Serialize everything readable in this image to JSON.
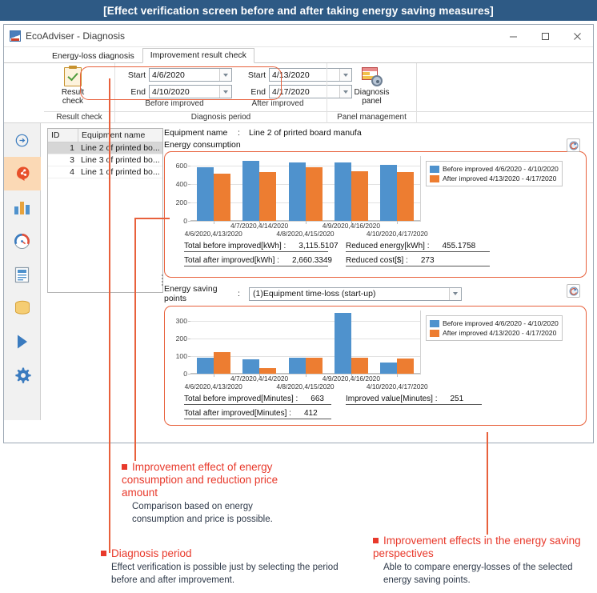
{
  "banner": {
    "text": "[Effect verification screen before and after taking energy saving measures]"
  },
  "window": {
    "title": "EcoAdviser - Diagnosis",
    "minimize": "–",
    "maximize": "□",
    "close": "✕"
  },
  "tabs": [
    {
      "label": "Energy-loss diagnosis",
      "active": false
    },
    {
      "label": "Improvement result check",
      "active": true
    }
  ],
  "ribbon": {
    "result_check": {
      "button_label_line1": "Result",
      "button_label_line2": "check",
      "group_title": "Result check"
    },
    "period": {
      "group_title": "Diagnosis period",
      "before": {
        "start_label": "Start",
        "start_value": "4/6/2020",
        "end_label": "End",
        "end_value": "4/10/2020",
        "caption": "Before improved"
      },
      "after": {
        "start_label": "Start",
        "start_value": "4/13/2020",
        "end_label": "End",
        "end_value": "4/17/2020",
        "caption": "After improved"
      }
    },
    "panel": {
      "button_label_line1": "Diagnosis",
      "button_label_line2": "panel",
      "group_title": "Panel management"
    }
  },
  "sidebar": {
    "items": [
      {
        "name": "expand-icon",
        "selected": false
      },
      {
        "name": "diagnosis-head-icon",
        "selected": true
      },
      {
        "name": "bar-chart-icon",
        "selected": false
      },
      {
        "name": "gauge-icon",
        "selected": false
      },
      {
        "name": "report-icon",
        "selected": false
      },
      {
        "name": "database-icon",
        "selected": false
      },
      {
        "name": "play-icon",
        "selected": false
      },
      {
        "name": "settings-gear-icon",
        "selected": false
      }
    ]
  },
  "equipment_list": {
    "headers": [
      "ID",
      "Equipment name"
    ],
    "rows": [
      {
        "id": "1",
        "name": "Line 2 of printed bo...",
        "selected": true
      },
      {
        "id": "3",
        "name": "Line 3 of printed bo...",
        "selected": false
      },
      {
        "id": "4",
        "name": "Line 1 of printed bo...",
        "selected": false
      }
    ]
  },
  "details": {
    "equipment_name_label": "Equipment name",
    "colon": ":",
    "equipment_name_value": "Line 2 of prirted board manufa",
    "energy_consumption_label": "Energy consumption",
    "energy_saving_points_label": "Energy saving points",
    "energy_saving_points_value": "(1)Equipment time-loss (start-up)",
    "refresh_icon": "refresh-icon"
  },
  "energy_totals": {
    "rows": [
      [
        {
          "key": "Total before improved[kWh] :",
          "value": "3,115.5107"
        },
        {
          "key": "Reduced energy[kWh] :",
          "value": "455.1758"
        }
      ],
      [
        {
          "key": "Total after improved[kWh] :",
          "value": "2,660.3349"
        },
        {
          "key": "Reduced cost[$] :",
          "value": "273"
        }
      ]
    ]
  },
  "saving_totals": {
    "rows": [
      [
        {
          "key": "Total before improved[Minutes] :",
          "value": "663"
        },
        {
          "key": "Improved value[Minutes] :",
          "value": "251"
        }
      ],
      [
        {
          "key": "Total after improved[Minutes] :",
          "value": "412"
        }
      ]
    ]
  },
  "colors": {
    "before": "#4f92cd",
    "after": "#ed7d31",
    "accent_red": "#e8613c",
    "callout_red": "#e8392b",
    "banner_blue": "#2e5a85"
  },
  "chart_data": [
    {
      "type": "bar",
      "title": "Energy consumption",
      "xlabel": "",
      "ylabel": "",
      "ylim": [
        0,
        700
      ],
      "yticks": [
        0,
        200,
        400,
        600
      ],
      "grid": true,
      "legend_position": "right",
      "categories": [
        "4/6/2020,4/13/2020",
        "4/7/2020,4/14/2020",
        "4/8/2020,4/15/2020",
        "4/9/2020,4/16/2020",
        "4/10/2020,4/17/2020"
      ],
      "series": [
        {
          "name": "Before improved 4/6/2020 - 4/10/2020",
          "color": "#4f92cd",
          "values": [
            575,
            645,
            633,
            630,
            605
          ]
        },
        {
          "name": "After improved 4/13/2020 - 4/17/2020",
          "color": "#ed7d31",
          "values": [
            510,
            523,
            583,
            535,
            524
          ]
        }
      ]
    },
    {
      "type": "bar",
      "title": "Energy saving points",
      "xlabel": "",
      "ylabel": "",
      "ylim": [
        0,
        360
      ],
      "yticks": [
        0,
        100,
        200,
        300
      ],
      "grid": true,
      "legend_position": "right",
      "categories": [
        "4/6/2020,4/13/2020",
        "4/7/2020,4/14/2020",
        "4/8/2020,4/15/2020",
        "4/9/2020,4/16/2020",
        "4/10/2020,4/17/2020"
      ],
      "series": [
        {
          "name": "Before improved 4/6/2020 - 4/10/2020",
          "color": "#4f92cd",
          "values": [
            93,
            83,
            89,
            345,
            62
          ]
        },
        {
          "name": "After improved 4/13/2020 - 4/17/2020",
          "color": "#ed7d31",
          "values": [
            122,
            30,
            92,
            91,
            88
          ]
        }
      ]
    }
  ],
  "callouts": [
    {
      "title": "Improvement effect of energy consumption and reduction price amount",
      "body": "Comparison based on energy consumption and price is possible."
    },
    {
      "title": "Diagnosis period",
      "body": "Effect verification is possible just by selecting the period before and after improvement."
    },
    {
      "title": "Improvement effects in the energy saving perspectives",
      "body": "Able to compare energy-losses of the selected energy saving points."
    }
  ]
}
